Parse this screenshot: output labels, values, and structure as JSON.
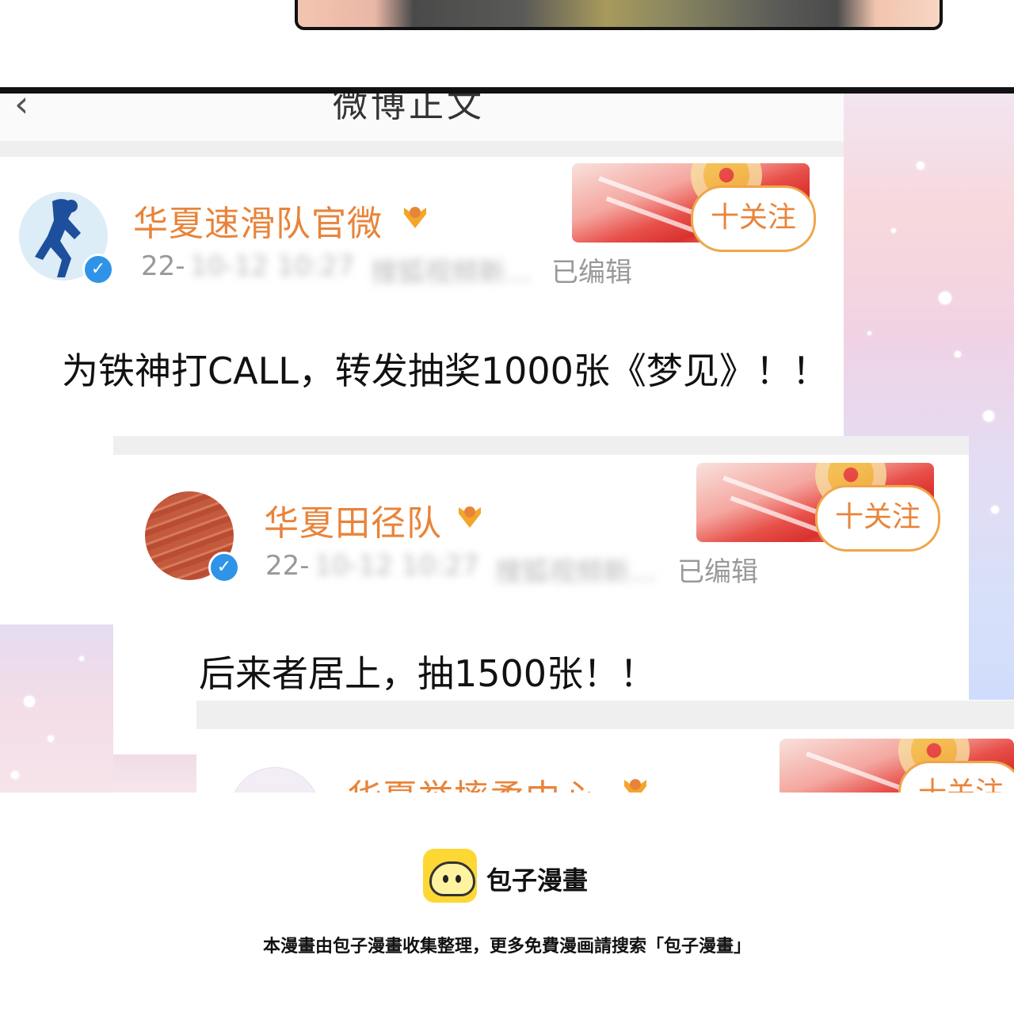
{
  "header": {
    "back_icon": "back-chevron-icon",
    "title": "微博正文"
  },
  "posts": [
    {
      "username": "华夏速滑队官微",
      "date_prefix": "22-",
      "date_blurred": "10-12 10:27",
      "source_blurred": "搜狐视频新…",
      "edited": "已编辑",
      "follow_label": "十关注",
      "text": "为铁神打CALL，转发抽奖1000张《梦见》！！"
    },
    {
      "username": "华夏田径队",
      "date_prefix": "22-",
      "date_blurred": "10-12 10:27",
      "source_blurred": "搜狐视频新…",
      "edited": "已编辑",
      "follow_label": "十关注",
      "text": "后来者居上，抽1500张！！"
    },
    {
      "username": "华夏举摔柔中心",
      "follow_label": "十关注"
    }
  ],
  "footer": {
    "logo_name": "包子漫畫",
    "note": "本漫畫由包子漫畫收集整理，更多免費漫画請搜索「包子漫畫」"
  },
  "colors": {
    "accent": "#e8843a",
    "verified": "#2f94e8",
    "follow_border": "#f0a54a"
  }
}
